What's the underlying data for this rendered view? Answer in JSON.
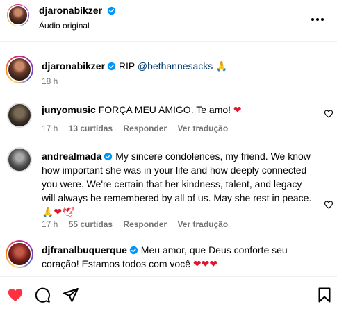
{
  "post": {
    "author": "djaronabikzer",
    "audio": "Áudio original"
  },
  "caption": {
    "username": "djaronabikzer",
    "text_prefix": "RIP ",
    "mention": "@bethannesacks",
    "emoji": "🙏",
    "time": "18 h"
  },
  "comments": [
    {
      "username": "junyomusic",
      "text": "FORÇA MEU AMIGO. Te amo! ",
      "emoji": "❤",
      "time": "17 h",
      "likes": "13 curtidas",
      "reply": "Responder",
      "translate": "Ver tradução"
    },
    {
      "username": "andrealmada",
      "text": "My sincere condolences, my friend. We know how important she was in your life and how deeply connected you were. We're certain that her kindness, talent, and legacy will always be remembered by all of us. May she rest in peace.",
      "emoji": "🙏❤🕊",
      "time": "17 h",
      "likes": "55 curtidas",
      "reply": "Responder",
      "translate": "Ver tradução"
    },
    {
      "username": "djfranalbuquerque",
      "text": "Meu amor, que Deus conforte seu coração! Estamos todos com você ",
      "emoji": "❤❤❤"
    }
  ],
  "colors": {
    "verified": "#0095f6",
    "like_red": "#ff3040",
    "meta_gray": "#737373"
  },
  "icons": [
    "heart-icon",
    "comment-icon",
    "share-icon",
    "bookmark-icon",
    "more-icon"
  ]
}
